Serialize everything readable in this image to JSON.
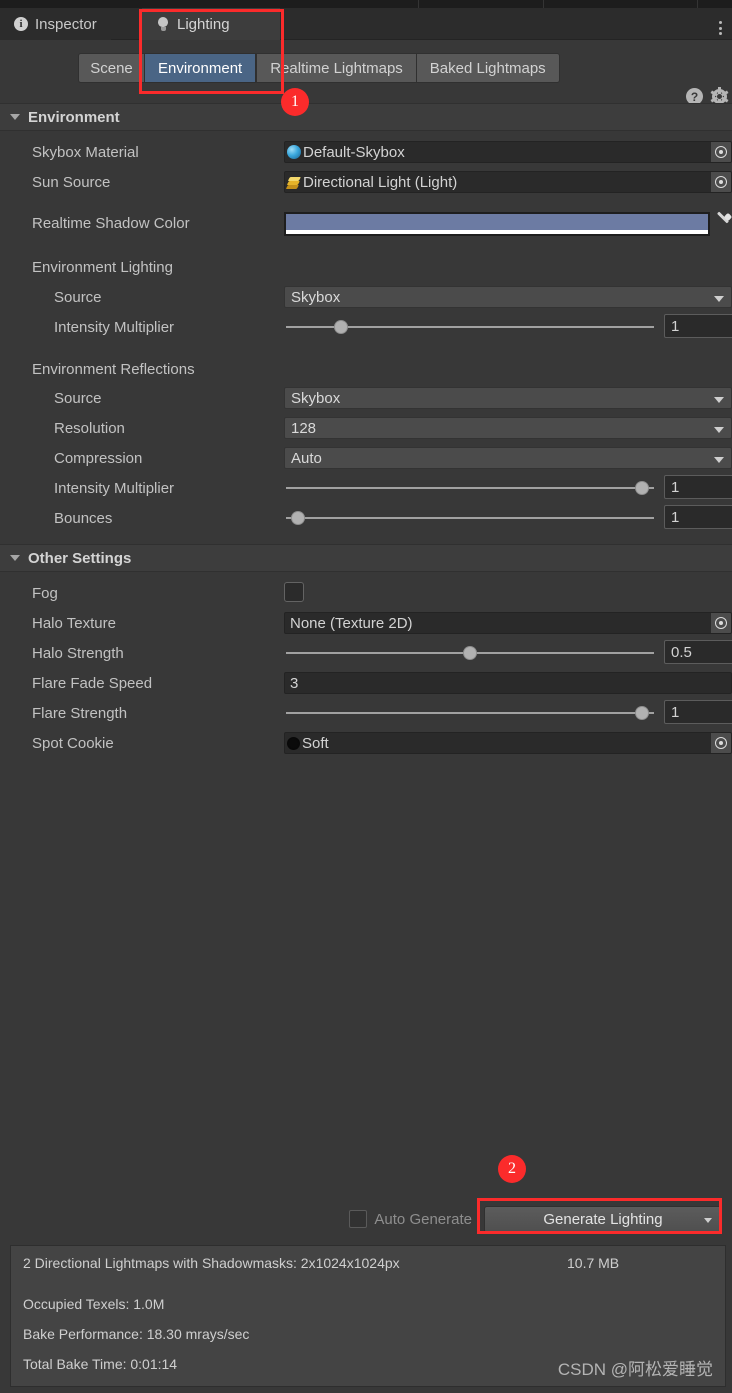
{
  "window": {
    "tabs": [
      {
        "label": "Inspector",
        "icon": "info-icon",
        "active": false
      },
      {
        "label": "Lighting",
        "icon": "bulb-icon",
        "active": true
      }
    ],
    "menu_icon": "kebab-menu-icon"
  },
  "subtabs": {
    "items": [
      {
        "label": "Scene",
        "selected": false
      },
      {
        "label": "Environment",
        "selected": true
      },
      {
        "label": "Realtime Lightmaps",
        "selected": false
      },
      {
        "label": "Baked Lightmaps",
        "selected": false
      }
    ],
    "help_icon": "help-icon",
    "settings_icon": "gear-icon"
  },
  "environment": {
    "header": "Environment",
    "skybox_material": {
      "label": "Skybox Material",
      "value": "Default-Skybox",
      "icon": "material-sphere-icon"
    },
    "sun_source": {
      "label": "Sun Source",
      "value": "Directional Light (Light)",
      "icon": "light-icon"
    },
    "realtime_shadow_color": {
      "label": "Realtime Shadow Color",
      "color": "#6c7ba3",
      "alpha_color": "#ffffff"
    },
    "lighting_group": "Environment Lighting",
    "lighting_source": {
      "label": "Source",
      "value": "Skybox"
    },
    "lighting_intensity": {
      "label": "Intensity Multiplier",
      "value": "1",
      "knob_pct": 14
    },
    "reflections_group": "Environment Reflections",
    "reflections_source": {
      "label": "Source",
      "value": "Skybox"
    },
    "reflections_resolution": {
      "label": "Resolution",
      "value": "128"
    },
    "reflections_compression": {
      "label": "Compression",
      "value": "Auto"
    },
    "reflections_intensity": {
      "label": "Intensity Multiplier",
      "value": "1",
      "knob_pct": 98
    },
    "reflections_bounces": {
      "label": "Bounces",
      "value": "1",
      "knob_pct": 2
    }
  },
  "other_settings": {
    "header": "Other Settings",
    "fog": {
      "label": "Fog",
      "checked": false
    },
    "halo_texture": {
      "label": "Halo Texture",
      "value": "None (Texture 2D)"
    },
    "halo_strength": {
      "label": "Halo Strength",
      "value": "0.5",
      "knob_pct": 50
    },
    "flare_fade_speed": {
      "label": "Flare Fade Speed",
      "value": "3"
    },
    "flare_strength": {
      "label": "Flare Strength",
      "value": "1",
      "knob_pct": 98
    },
    "spot_cookie": {
      "label": "Spot Cookie",
      "value": "Soft",
      "icon": "cookie-circle-icon"
    }
  },
  "bottom": {
    "auto_generate": {
      "label": "Auto Generate",
      "checked": false
    },
    "generate_button": "Generate Lighting"
  },
  "stats": {
    "lightmaps_line": "2 Directional Lightmaps with Shadowmasks: 2x1024x1024px",
    "lightmaps_size": "10.7 MB",
    "occupied_texels": "Occupied Texels: 1.0M",
    "bake_performance": "Bake Performance: 18.30 mrays/sec",
    "total_bake_time": "Total Bake Time: 0:01:14",
    "watermark": "CSDN @阿松爱睡觉"
  },
  "annotations": {
    "badge_one": "1",
    "badge_two": "2",
    "accent_color": "#fb2b2b"
  }
}
